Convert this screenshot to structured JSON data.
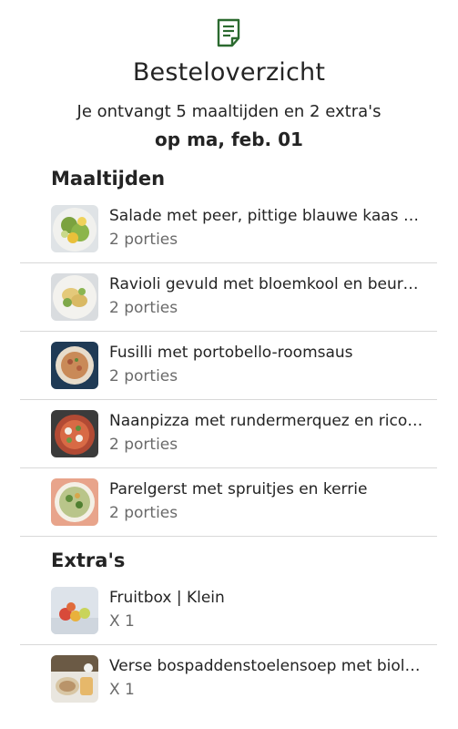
{
  "header": {
    "icon": "document-icon",
    "accent_color": "#2b6a2f",
    "title": "Besteloverzicht",
    "subtitle": "Je ontvangt 5 maaltijden en 2 extra's",
    "date": "op ma, feb. 01"
  },
  "meals": {
    "section_title": "Maaltijden",
    "items": [
      {
        "name": "Salade met peer, pittige blauwe kaas en walnoten",
        "sub": "2 porties"
      },
      {
        "name": "Ravioli gevuld met bloemkool en beurre blanc",
        "sub": "2 porties"
      },
      {
        "name": "Fusilli met portobello-roomsaus",
        "sub": "2 porties"
      },
      {
        "name": "Naanpizza met rundermerquez en ricotta",
        "sub": "2 porties"
      },
      {
        "name": "Parelgerst met spruitjes en kerrie",
        "sub": "2 porties"
      }
    ]
  },
  "extras": {
    "section_title": "Extra's",
    "items": [
      {
        "name": "Fruitbox | Klein",
        "sub": "X 1"
      },
      {
        "name": "Verse bospaddenstoelensoep met biologische room",
        "sub": "X 1"
      }
    ]
  }
}
